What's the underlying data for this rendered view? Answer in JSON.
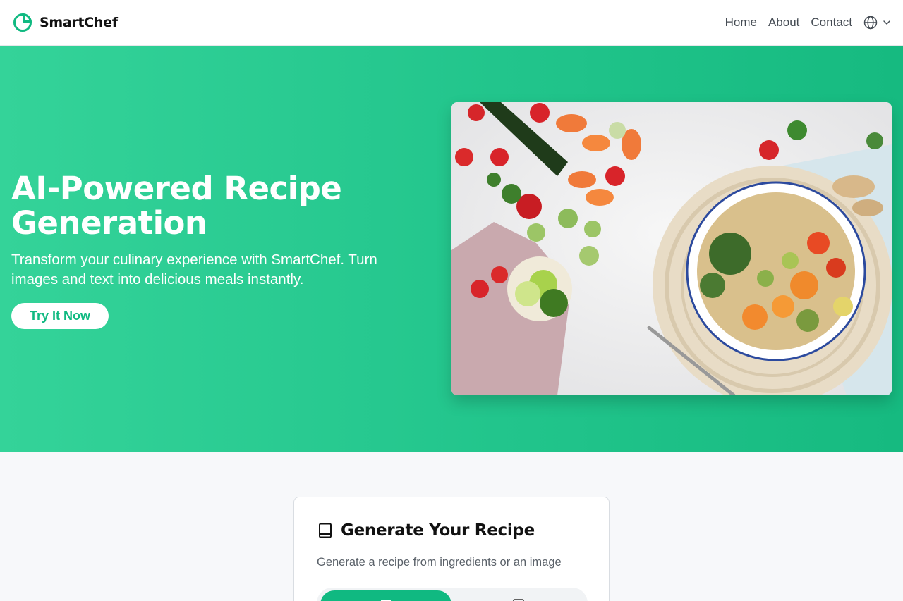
{
  "brand": {
    "name": "SmartChef",
    "logo_icon": "smartchef-logo-icon",
    "accent": "#10b981"
  },
  "nav": {
    "links": [
      "Home",
      "About",
      "Contact"
    ],
    "language_icon": "globe-icon",
    "dropdown_icon": "chevron-down-icon"
  },
  "hero": {
    "title": "AI-Powered Recipe Generation",
    "subtitle": "Transform your culinary experience with SmartChef. Turn images and text into delicious meals instantly.",
    "cta_label": "Try It Now",
    "image_subject": "bowl of quinoa with roasted vegetables, tomatoes, carrots, zucchini and limes on white table"
  },
  "card": {
    "icon": "book-icon",
    "title": "Generate Your Recipe",
    "description": "Generate a recipe from ingredients or an image",
    "tabs": [
      {
        "icon": "text-icon",
        "active": true
      },
      {
        "icon": "image-icon",
        "active": false
      }
    ]
  }
}
